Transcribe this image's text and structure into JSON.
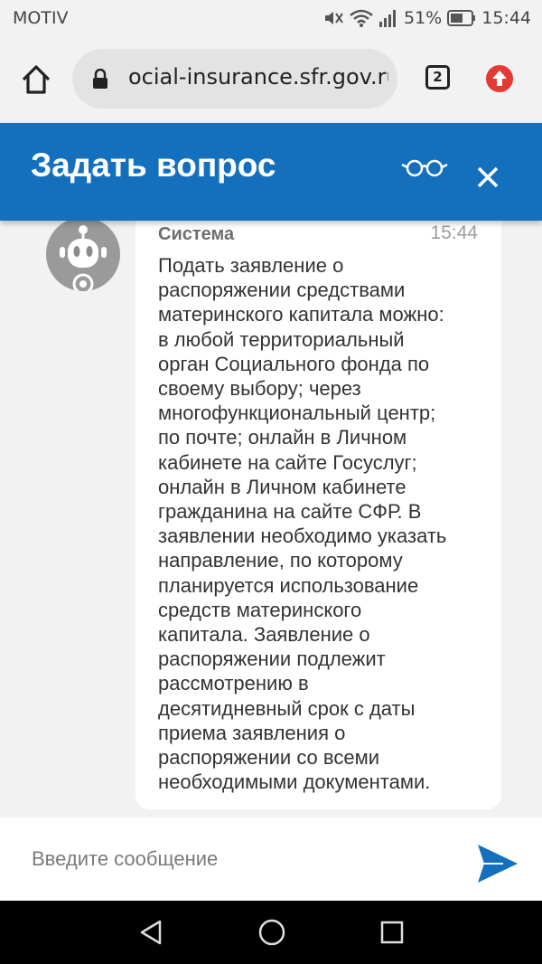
{
  "status_bar": {
    "carrier": "MOTIV",
    "battery": "51%",
    "time": "15:44",
    "icons": [
      "mute-icon",
      "wifi-icon",
      "signal-icon",
      "battery-icon"
    ]
  },
  "browser": {
    "url": "ocial-insurance.sfr.gov.ru",
    "tab_count": "2",
    "icons": [
      "home-icon",
      "lock-icon",
      "update-icon"
    ]
  },
  "chat": {
    "title": "Задать вопрос",
    "header_icons": [
      "glasses-icon",
      "close-icon"
    ],
    "colors": {
      "header": "#1470bc",
      "send": "#1470bc"
    },
    "message": {
      "sender": "Система",
      "time": "15:44",
      "lines": [
        "Подать заявление о",
        "распоряжении средствами",
        "материнского капитала можно:",
        "в любой территориальный",
        "орган Социального фонда по",
        "своему выбору; через",
        "многофункциональный центр;",
        "по почте; онлайн в Личном",
        "кабинете на сайте Госуслуг;",
        "онлайн в Личном кабинете",
        "гражданина на сайте СФР. В",
        "заявлении необходимо указать",
        "направление, по которому",
        "планируется использование",
        "средств материнского",
        "капитала. Заявление о",
        "распоряжении подлежит",
        "рассмотрению в",
        "десятидневный срок с даты",
        "приема заявления о",
        "распоряжении со всеми",
        "необходимыми документами."
      ]
    },
    "input_placeholder": "Введите сообщение"
  },
  "nav_bar": {
    "icons": [
      "back-icon",
      "home-circle-icon",
      "recents-icon"
    ]
  }
}
